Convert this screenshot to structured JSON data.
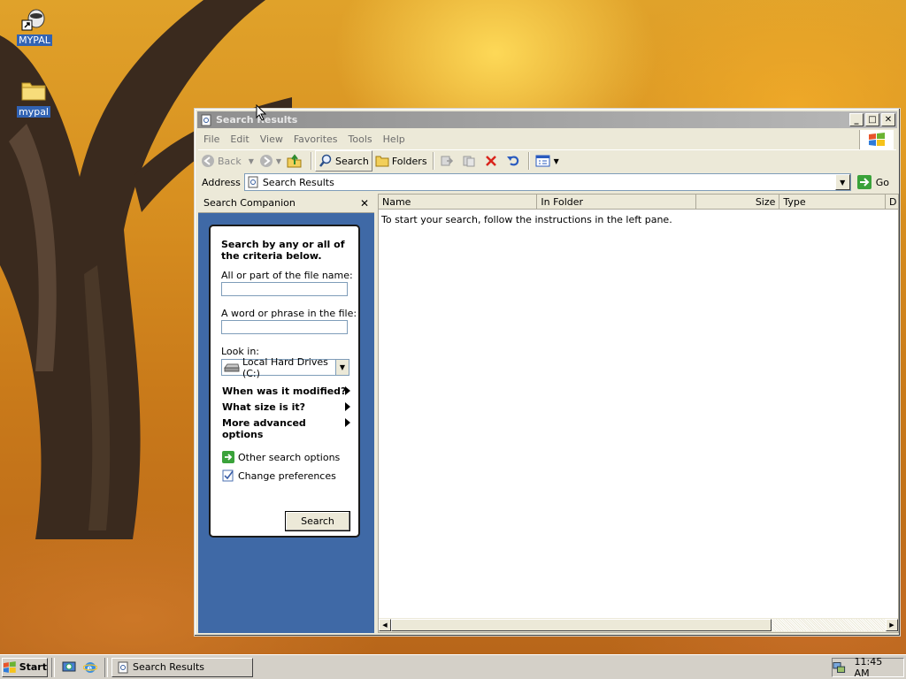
{
  "desktop": {
    "icons": [
      {
        "label": "MYPAL",
        "icon": "mypal-shortcut-icon"
      },
      {
        "label": "mypal",
        "icon": "folder-icon"
      }
    ]
  },
  "window": {
    "title": "Search Results",
    "menu": {
      "file": "File",
      "edit": "Edit",
      "view": "View",
      "favorites": "Favorites",
      "tools": "Tools",
      "help": "Help"
    },
    "toolbar": {
      "back": "Back",
      "search": "Search",
      "folders": "Folders"
    },
    "address": {
      "label": "Address",
      "value": "Search Results",
      "go": "Go"
    }
  },
  "search_companion": {
    "title": "Search Companion",
    "heading": "Search by any or all of the criteria below.",
    "file_name_label": "All or part of the file name:",
    "file_name_value": "",
    "phrase_label": "A word or phrase in the file:",
    "phrase_value": "",
    "look_in_label": "Look in:",
    "look_in_value": "Local Hard Drives (C:)",
    "options": [
      "When was it modified?",
      "What size is it?",
      "More advanced options"
    ],
    "links": [
      "Other search options",
      "Change preferences"
    ],
    "search_button": "Search"
  },
  "results": {
    "columns": [
      "Name",
      "In Folder",
      "Size",
      "Type",
      "D"
    ],
    "message": "To start your search, follow the instructions in the left pane."
  },
  "taskbar": {
    "start": "Start",
    "tasks": [
      "Search Results"
    ],
    "clock": "11:45 AM"
  },
  "colors": {
    "left_pane_bg": "#3f69a6",
    "title_inactive": "#a0a0a0",
    "chrome": "#ece9d8"
  }
}
